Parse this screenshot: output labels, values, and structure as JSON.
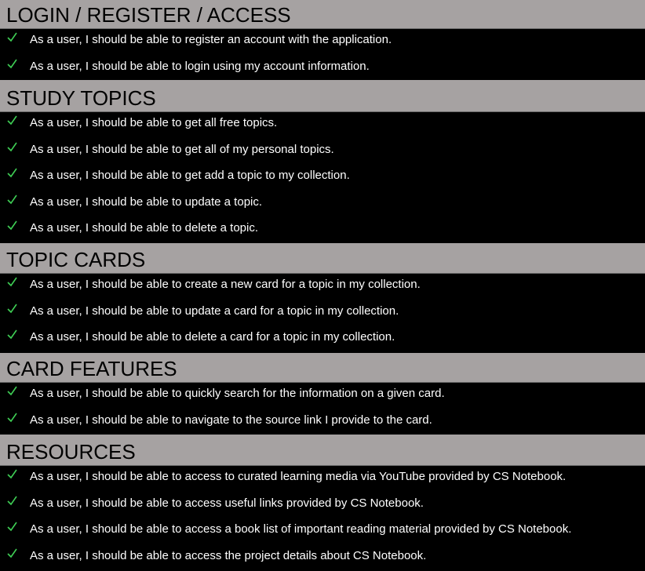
{
  "colors": {
    "header_bg": "#a6a2a2",
    "body_bg": "#000000",
    "check": "#3fcf55",
    "text": "#ffffff"
  },
  "sections": [
    {
      "title": "LOGIN / REGISTER / ACCESS",
      "items": [
        "As a user, I should be able to register an account with the application.",
        "As a user, I should be able to login using my account information."
      ]
    },
    {
      "title": "STUDY TOPICS",
      "items": [
        "As a user, I should be able to get all free topics.",
        "As a user, I should be able to get all of my personal topics.",
        "As a user, I should be able to get add a topic to my collection.",
        "As a user, I should be able to update a topic.",
        "As a user, I should be able to delete a topic."
      ]
    },
    {
      "title": "TOPIC CARDS",
      "items": [
        "As a user, I should be able to create a new card for a topic in my collection.",
        "As a user, I should be able to update a card for a topic in my collection.",
        "As a user, I should be able to delete a card for a topic in my collection."
      ]
    },
    {
      "title": "CARD FEATURES",
      "items": [
        "As a user, I should be able to quickly search for the information on a given card.",
        "As a user, I should be able to navigate to the source link I provide to the card."
      ]
    },
    {
      "title": "RESOURCES",
      "items": [
        "As a user, I should be able to access to curated learning media via YouTube provided by CS Notebook.",
        "As a user, I should be able to access useful links provided by CS Notebook.",
        "As a user, I should be able to access a book list of important reading material provided by CS Notebook.",
        "As a user, I should be able to access the project details about CS Notebook."
      ]
    }
  ]
}
